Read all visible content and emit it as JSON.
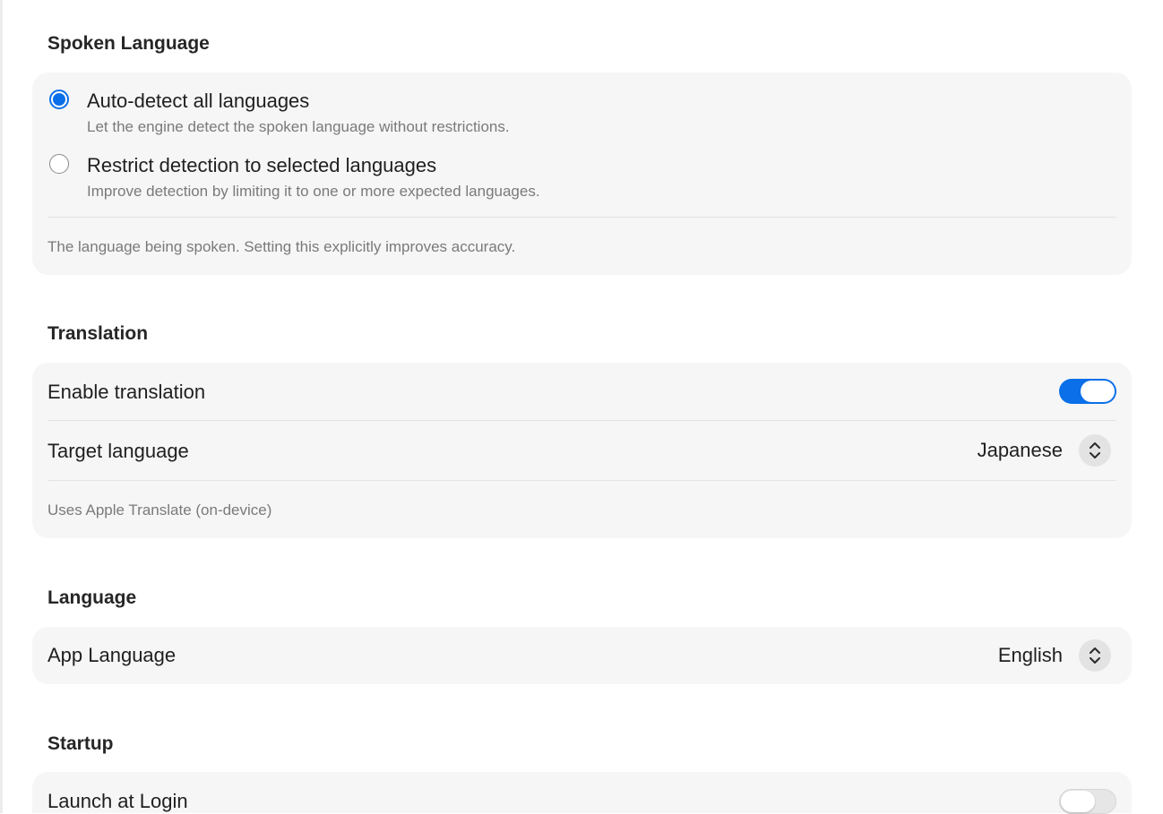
{
  "spoken_language": {
    "title": "Spoken Language",
    "options": [
      {
        "label": "Auto-detect all languages",
        "description": "Let the engine detect the spoken language without restrictions.",
        "selected": true
      },
      {
        "label": "Restrict detection to selected languages",
        "description": "Improve detection by limiting it to one or more expected languages.",
        "selected": false
      }
    ],
    "footnote": "The language being spoken. Setting this explicitly improves accuracy."
  },
  "translation": {
    "title": "Translation",
    "enable_label": "Enable translation",
    "enable_on": true,
    "target_label": "Target language",
    "target_value": "Japanese",
    "footnote": "Uses Apple Translate (on-device)"
  },
  "language": {
    "title": "Language",
    "app_language_label": "App Language",
    "app_language_value": "English"
  },
  "startup": {
    "title": "Startup",
    "launch_label": "Launch at Login",
    "launch_on": false
  },
  "colors": {
    "accent": "#0a6fe8",
    "group_background": "#f6f6f6",
    "secondary_text": "#7a7a7a"
  },
  "icons": {
    "stepper": "chevron-up-down-icon"
  }
}
